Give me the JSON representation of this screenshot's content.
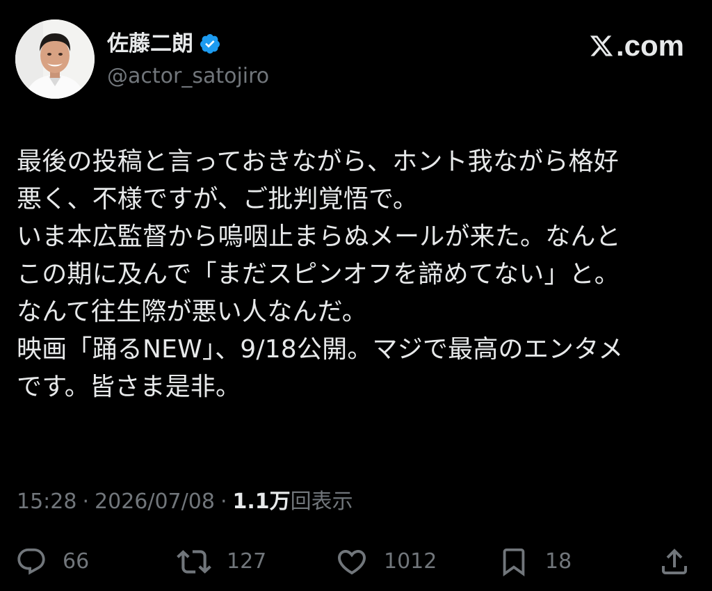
{
  "site": {
    "brand": ".com",
    "brand_icon": "x-logo-icon"
  },
  "author": {
    "display_name": "佐藤二朗",
    "handle": "@actor_satojiro",
    "verified": true,
    "verified_color": "#1d9bf0",
    "avatar_icon": "avatar"
  },
  "post": {
    "lines": [
      "最後の投稿と言っておきながら、ホント我ながら格好",
      "悪く、不様ですが、ご批判覚悟で。",
      "いま本広監督から嗚咽止まらぬメールが来た。なんと",
      "この期に及んで「まだスピンオフを諦めてない」と。",
      "なんて往生際が悪い人なんだ。",
      "映画「踊るNEW」、9/18公開。マジで最高のエンタメ",
      "です。皆さま是非。"
    ]
  },
  "meta": {
    "time": "15:28",
    "date": "2026/07/08",
    "views_count": "1.1万",
    "views_label": "回表示"
  },
  "actions": {
    "reply": {
      "icon": "reply-icon",
      "count": "66"
    },
    "repost": {
      "icon": "repost-icon",
      "count": "127"
    },
    "like": {
      "icon": "heart-icon",
      "count": "1012"
    },
    "bookmark": {
      "icon": "bookmark-icon",
      "count": "18"
    },
    "share": {
      "icon": "share-icon"
    }
  },
  "colors": {
    "background": "#000000",
    "text_primary": "#e7e9ea",
    "text_secondary": "#71767b",
    "accent": "#1d9bf0"
  }
}
